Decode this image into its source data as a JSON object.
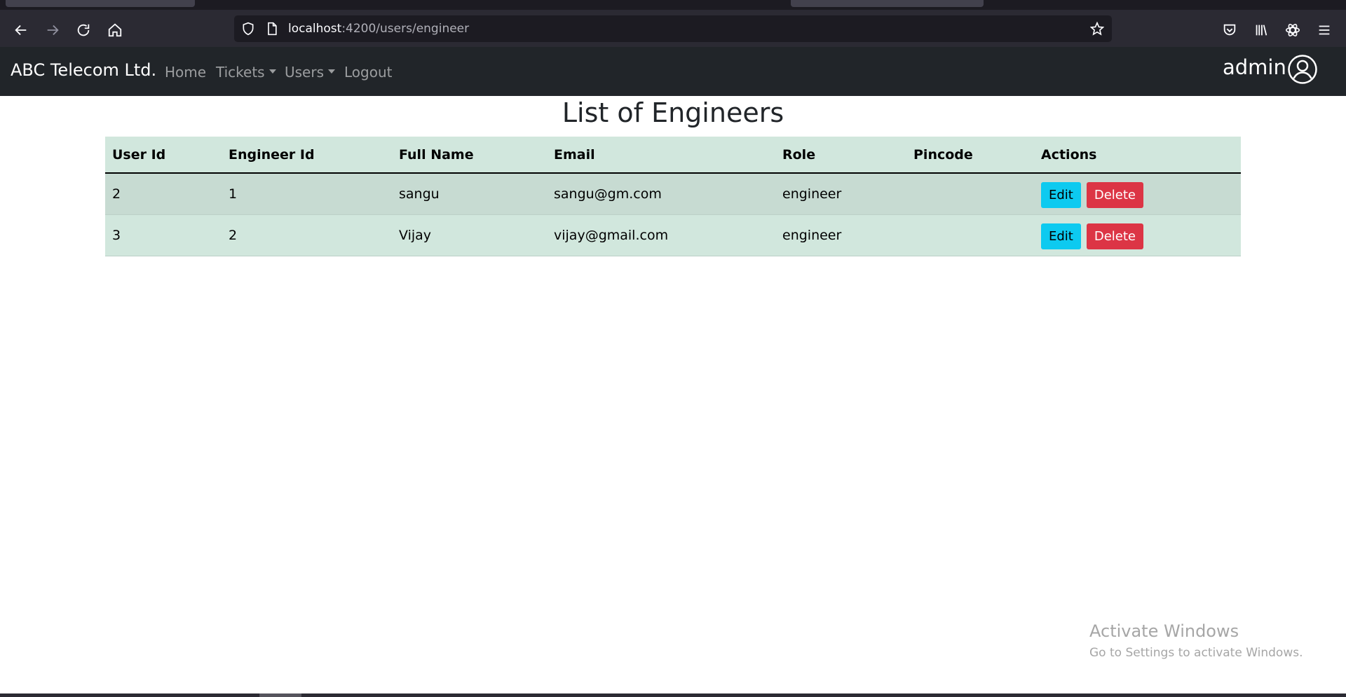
{
  "browser": {
    "url_host": "localhost",
    "url_path": ":4200/users/engineer",
    "icons": [
      "back-icon",
      "forward-icon",
      "reload-icon",
      "home-icon",
      "shield-icon",
      "page-icon",
      "star-icon",
      "pocket-icon",
      "library-icon",
      "extension-icon",
      "menu-icon"
    ]
  },
  "navbar": {
    "brand": "ABC Telecom Ltd.",
    "links": {
      "home": "Home",
      "tickets": "Tickets",
      "users": "Users",
      "logout": "Logout"
    },
    "user_name": "admin"
  },
  "page": {
    "title": "List of Engineers"
  },
  "table": {
    "headers": [
      "User Id",
      "Engineer Id",
      "Full Name",
      "Email",
      "Role",
      "Pincode",
      "Actions"
    ],
    "rows": [
      {
        "user_id": "2",
        "engineer_id": "1",
        "full_name": "sangu",
        "email": "sangu@gm.com",
        "role": "engineer",
        "pincode": ""
      },
      {
        "user_id": "3",
        "engineer_id": "2",
        "full_name": "Vijay",
        "email": "vijay@gmail.com",
        "role": "engineer",
        "pincode": ""
      }
    ],
    "edit_label": "Edit",
    "delete_label": "Delete"
  },
  "watermark": {
    "title": "Activate Windows",
    "subtitle": "Go to Settings to activate Windows."
  },
  "colors": {
    "navbar_bg": "#212529",
    "table_bg": "#d1e7dd",
    "edit_button": "#0dcaf0",
    "delete_button": "#dc3545"
  }
}
